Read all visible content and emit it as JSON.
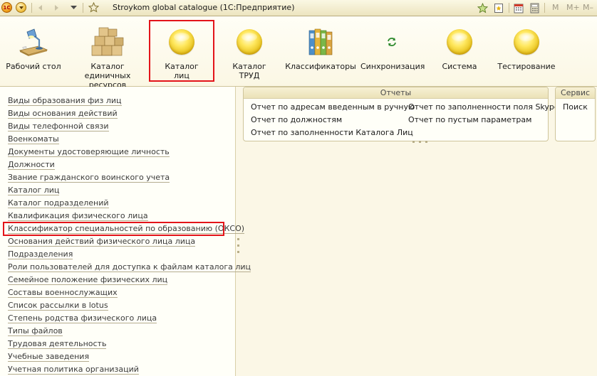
{
  "window": {
    "title": "Stroykom global catalogue  (1С:Предприятие)",
    "logo_text": "1С",
    "right_text": [
      "M",
      "M+",
      "M–"
    ]
  },
  "sections": [
    {
      "label": "Рабочий стол",
      "icon": "desktop-lamp-icon"
    },
    {
      "label": "Каталог единичных ресурсов",
      "icon": "boxes-icon"
    },
    {
      "label": "Каталог лиц",
      "icon": "yellow-ball-icon",
      "selected": true
    },
    {
      "label": "Каталог ТРУД",
      "icon": "yellow-ball-icon"
    },
    {
      "label": "Классификаторы",
      "icon": "binders-icon"
    },
    {
      "label": "Синхронизация",
      "icon": "sync-arrows-icon"
    },
    {
      "label": "Система",
      "icon": "yellow-ball-icon"
    },
    {
      "label": "Тестирование",
      "icon": "yellow-ball-icon"
    }
  ],
  "nav_items": [
    "Виды образования физ лиц",
    "Виды основания действий",
    "Виды телефонной связи",
    "Военкоматы",
    "Документы удостоверяющие личность",
    "Должности",
    "Звание гражданского воинского учета",
    "Каталог лиц",
    "Каталог подразделений",
    "Квалификация физического лица",
    "Классификатор специальностей по образованию (ОКСО)",
    "Основания действий физического лица лица",
    "Подразделения",
    "Роли пользователей для доступка к файлам каталога лиц",
    "Семейное положение физических лиц",
    "Составы военнослужащих",
    "Список рассылки в lotus",
    "Степень родства физического лица",
    "Типы файлов",
    "Трудовая деятельность",
    "Учебные заведения",
    "Учетная политика организаций"
  ],
  "highlighted_nav_index": 10,
  "reports": {
    "title": "Отчеты",
    "col1": [
      "Отчет по адресам введенным в ручную",
      "Отчет по должностям",
      "Отчет по заполненности Каталога Лиц"
    ],
    "col2": [
      "Отчет по заполненности поля Skype",
      "Отчет по пустым параметрам"
    ]
  },
  "service": {
    "title": "Сервис",
    "items": [
      "Поиск"
    ]
  },
  "colors": {
    "highlight_border": "#e3141a",
    "background": "#fbf7e6"
  }
}
